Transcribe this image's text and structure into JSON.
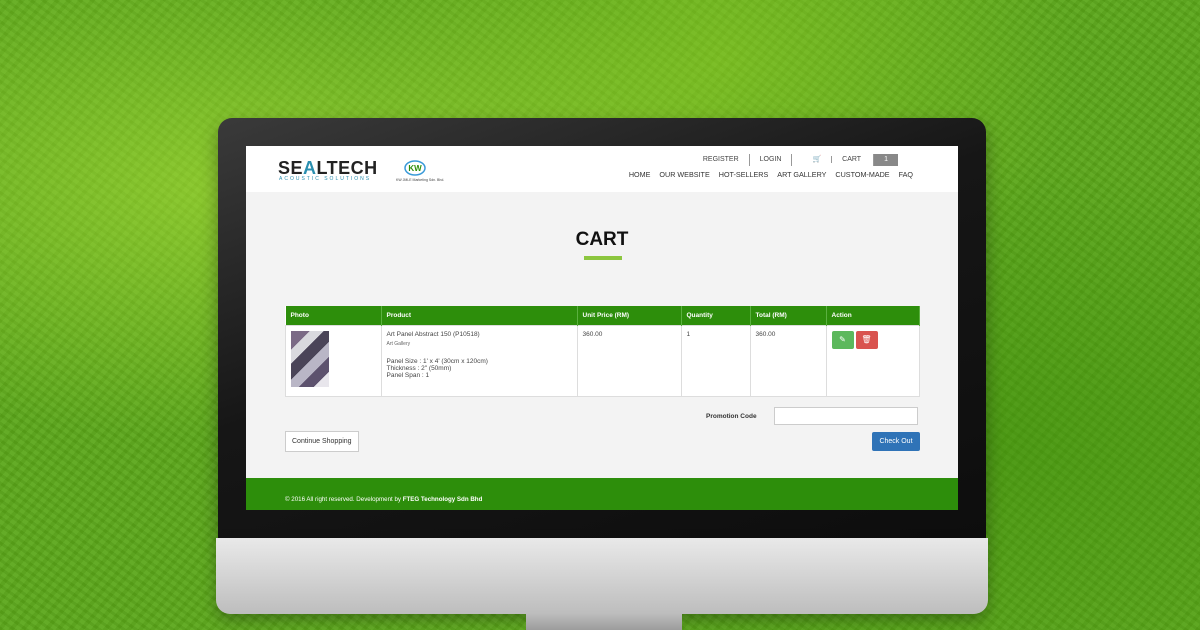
{
  "brand": {
    "logo_text_1": "SE",
    "logo_text_accent": "A",
    "logo_text_2": "LTECH",
    "logo_tagline": "ACOUSTIC SOLUTIONS",
    "partner_name": "KW JMLE Marketing Sdn. Bhd."
  },
  "top_links": {
    "register": "REGISTER",
    "login": "LOGIN",
    "cart": "CART",
    "cart_count": "1"
  },
  "nav": [
    "HOME",
    "OUR WEBSITE",
    "HOT-SELLERS",
    "ART GALLERY",
    "CUSTOM-MADE",
    "FAQ"
  ],
  "page": {
    "title": "CART"
  },
  "table": {
    "headers": [
      "Photo",
      "Product",
      "Unit Price (RM)",
      "Quantity",
      "Total (RM)",
      "Action"
    ],
    "rows": [
      {
        "product_name": "Art Panel Abstract 150 (P10518)",
        "category": "Art Gallery",
        "panel_size": "Panel Size : 1' x 4' (30cm x 120cm)",
        "thickness": "Thickness : 2\" (50mm)",
        "panel_span": "Panel Span : 1",
        "unit_price": "360.00",
        "quantity": "1",
        "total": "360.00"
      }
    ]
  },
  "promo": {
    "label": "Promotion Code",
    "value": ""
  },
  "buttons": {
    "continue": "Continue Shopping",
    "checkout": "Check Out"
  },
  "footer": {
    "text": "© 2016 All right reserved. Development by ",
    "company": "FTEG Technology Sdn Bhd"
  },
  "icons": {
    "cart": "cart-icon",
    "edit": "edit-icon",
    "delete": "trash-icon"
  },
  "colors": {
    "primary_green": "#2d8e0b",
    "accent_green": "#8cc63f",
    "checkout_blue": "#2f73b7",
    "edit_green": "#5cb85c",
    "delete_red": "#d9534f"
  }
}
